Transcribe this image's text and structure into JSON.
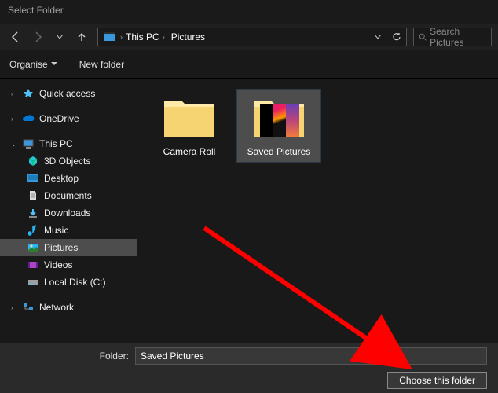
{
  "title": "Select Folder",
  "breadcrumb": {
    "root": "This PC",
    "loc": "Pictures"
  },
  "search": {
    "placeholder": "Search Pictures"
  },
  "toolbar": {
    "organise": "Organise",
    "newfolder": "New folder"
  },
  "sidebar": {
    "quick": "Quick access",
    "onedrive": "OneDrive",
    "thispc": "This PC",
    "items": {
      "objects3d": "3D Objects",
      "desktop": "Desktop",
      "documents": "Documents",
      "downloads": "Downloads",
      "music": "Music",
      "pictures": "Pictures",
      "videos": "Videos",
      "localdisk": "Local Disk (C:)"
    },
    "network": "Network"
  },
  "folders": {
    "cameraroll": "Camera Roll",
    "savedpictures": "Saved Pictures"
  },
  "footer": {
    "label": "Folder:",
    "value": "Saved Pictures",
    "choose": "Choose this folder"
  }
}
